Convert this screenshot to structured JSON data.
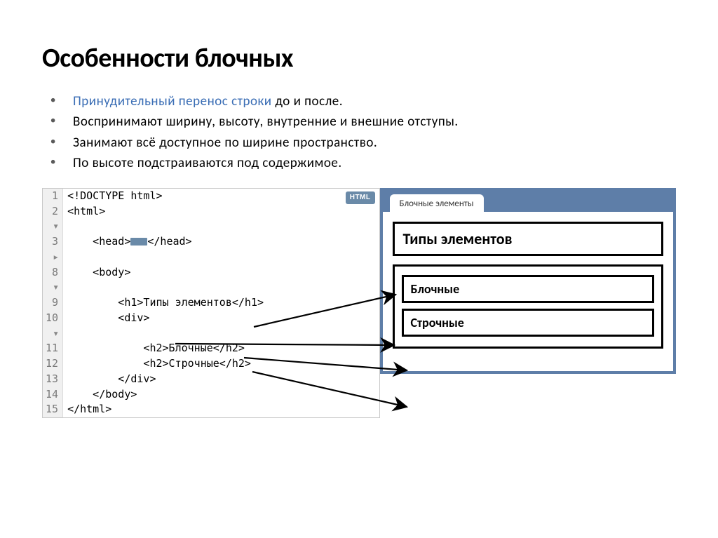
{
  "title": "Особенности блочных",
  "bullets": [
    {
      "link": "Принудительный перенос строки",
      "rest": " до и после."
    },
    {
      "text": "Воспринимают ширину, высоту, внутренние и внешние отступы."
    },
    {
      "text": "Занимают всё доступное по ширине пространство."
    },
    {
      "text": "По высоте подстраиваются под содержимое."
    }
  ],
  "code": {
    "badge": "HTML",
    "lines": [
      {
        "n": "1",
        "fold": "",
        "text": "<!DOCTYPE html>"
      },
      {
        "n": "2",
        "fold": "▾",
        "text": "<html>"
      },
      {
        "n": "3",
        "fold": "▸",
        "text": "    <head>",
        "collapsed": true,
        "tail": "</head>"
      },
      {
        "n": "8",
        "fold": "▾",
        "text": "    <body>"
      },
      {
        "n": "9",
        "fold": "",
        "text": "        <h1>Типы элементов</h1>"
      },
      {
        "n": "10",
        "fold": "▾",
        "text": "        <div>"
      },
      {
        "n": "11",
        "fold": "",
        "text": "            <h2>Блочные</h2>"
      },
      {
        "n": "12",
        "fold": "",
        "text": "            <h2>Строчные</h2>"
      },
      {
        "n": "13",
        "fold": "",
        "text": "        </div>"
      },
      {
        "n": "14",
        "fold": "",
        "text": "    </body>"
      },
      {
        "n": "15",
        "fold": "",
        "text": "</html>"
      }
    ]
  },
  "browser": {
    "tab_title": "Блочные элементы",
    "h1": "Типы элементов",
    "h2a": "Блочные",
    "h2b": "Строчные"
  }
}
